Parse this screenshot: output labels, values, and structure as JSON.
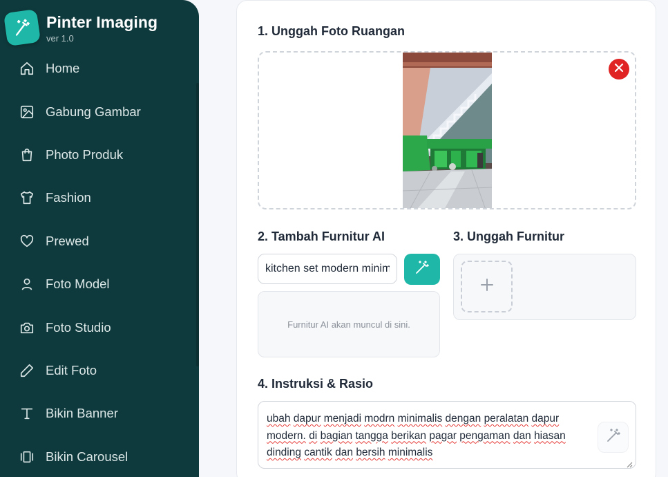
{
  "app": {
    "title": "Pinter Imaging",
    "version": "ver 1.0",
    "logo_icon": "magic-wand-icon",
    "accent_color": "#1fb8a8",
    "sidebar_color": "#0f3a3d"
  },
  "sidebar": {
    "items": [
      {
        "label": "Home",
        "icon": "home-icon"
      },
      {
        "label": "Gabung Gambar",
        "icon": "image-icon"
      },
      {
        "label": "Photo Produk",
        "icon": "shopping-bag-icon"
      },
      {
        "label": "Fashion",
        "icon": "shirt-icon"
      },
      {
        "label": "Prewed",
        "icon": "heart-icon"
      },
      {
        "label": "Foto Model",
        "icon": "user-icon"
      },
      {
        "label": "Foto Studio",
        "icon": "camera-icon"
      },
      {
        "label": "Edit Foto",
        "icon": "pencil-icon"
      },
      {
        "label": "Bikin Banner",
        "icon": "text-icon"
      },
      {
        "label": "Bikin Carousel",
        "icon": "carousel-icon"
      }
    ]
  },
  "main": {
    "section1": {
      "title": "1. Unggah Foto Ruangan",
      "remove_icon": "close-icon",
      "remove_color": "#e02424"
    },
    "section2": {
      "title": "2. Tambah Furnitur AI",
      "input_value": "kitchen set modern minimalis",
      "generate_icon": "magic-wand-icon",
      "placeholder_text": "Furnitur AI akan muncul di sini."
    },
    "section3": {
      "title": "3. Unggah Furnitur",
      "add_icon": "plus-icon"
    },
    "section4": {
      "title": "4. Instruksi & Rasio",
      "instruction_text": "ubah dapur menjadi modrn minimalis dengan peralatan dapur modern. di bagian tangga berikan pagar pengaman dan hiasan dinding cantik dan bersih minimalis",
      "magic_icon": "magic-wand-icon"
    }
  }
}
